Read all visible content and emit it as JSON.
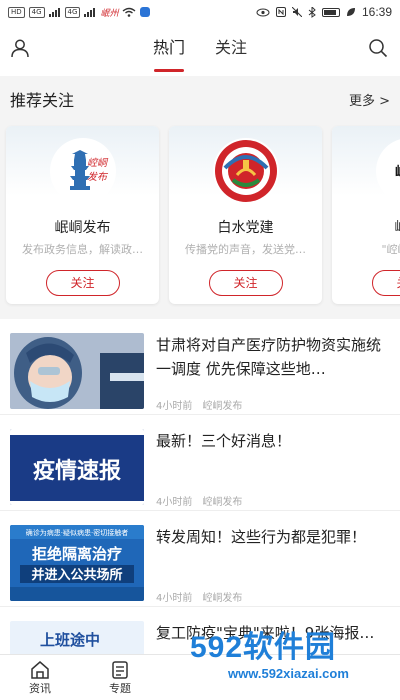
{
  "status_bar": {
    "left_chips": [
      "HD",
      "4G",
      "4G"
    ],
    "app_hint": "岷州",
    "time": "16:39"
  },
  "header": {
    "tabs": [
      {
        "label": "热门",
        "active": true
      },
      {
        "label": "关注",
        "active": false
      }
    ]
  },
  "recommend": {
    "title": "推荐关注",
    "more": "更多 >",
    "cards": [
      {
        "name": "岷峒发布",
        "desc": "发布政务信息，解读政…",
        "follow": "关注",
        "logo_text": "崆峒发布"
      },
      {
        "name": "白水党建",
        "desc": "传播党的声音，发送党…",
        "follow": "关注",
        "logo_text": "白水党建"
      },
      {
        "name": "崆峒",
        "desc": "\"崆峒财政\"",
        "follow": "关注",
        "logo_text": "崆峒"
      }
    ]
  },
  "news": [
    {
      "title": "甘肃将对自产医疗防护物资实施统一调度 优先保障这些地…",
      "time": "4小时前",
      "source": "崆峒发布",
      "thumb": "mask"
    },
    {
      "title": "最新！三个好消息！",
      "time": "4小时前",
      "source": "崆峒发布",
      "thumb": "疫情速报"
    },
    {
      "title": "转发周知！这些行为都是犯罪！",
      "time": "4小时前",
      "source": "崆峒发布",
      "thumb": "拒绝隔离治疗"
    },
    {
      "title": "复工防疫\"宝典\"来啦！9张海报…",
      "time": "",
      "source": "",
      "thumb": "上班途中"
    }
  ],
  "thumb_text": {
    "epidemic": "疫情速报",
    "refuse_top": "确诊为病患·疑似病患·密切接触者",
    "refuse_main": "拒绝隔离治疗",
    "refuse_sub": "并进入公共场所",
    "commute": "上班途中"
  },
  "bottom_nav": [
    {
      "label": "资讯",
      "icon": "home-icon"
    },
    {
      "label": "专题",
      "icon": "topic-icon"
    }
  ],
  "watermark": {
    "brand": "592软件园",
    "url": "www.592xiazai.com"
  },
  "colors": {
    "accent": "#d0252a",
    "watermark": "#1f7fd8"
  }
}
